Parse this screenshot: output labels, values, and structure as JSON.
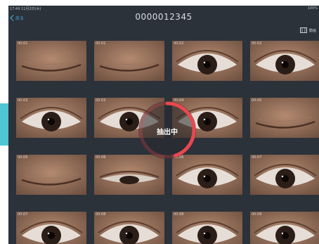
{
  "status_bar": {
    "time_date": "17:49  11月2日(木)",
    "battery": "100%"
  },
  "nav": {
    "back_label": "戻る",
    "title": "0000012345",
    "video_label": "動画"
  },
  "thumbnails": [
    {
      "time": "00:01",
      "kind": "closed"
    },
    {
      "time": "00:01",
      "kind": "closed"
    },
    {
      "time": "00:02",
      "kind": "open"
    },
    {
      "time": "00:02",
      "kind": "open"
    },
    {
      "time": "00:03",
      "kind": "open"
    },
    {
      "time": "00:03",
      "kind": "open"
    },
    {
      "time": "00:04",
      "kind": "open"
    },
    {
      "time": "00:05",
      "kind": "closed"
    },
    {
      "time": "00:05",
      "kind": "closed"
    },
    {
      "time": "00:06",
      "kind": "half"
    },
    {
      "time": "00:06",
      "kind": "open"
    },
    {
      "time": "00:07",
      "kind": "open"
    },
    {
      "time": "00:07",
      "kind": "open"
    },
    {
      "time": "00:08",
      "kind": "open"
    },
    {
      "time": "00:08",
      "kind": "open"
    },
    {
      "time": "00:09",
      "kind": "open"
    }
  ],
  "overlay": {
    "label": "抽出中",
    "progress": 0.45
  },
  "colors": {
    "background": "#2b323a",
    "accent": "#4ec6d4",
    "progress": "#e8484f",
    "link": "#48a8d8"
  }
}
